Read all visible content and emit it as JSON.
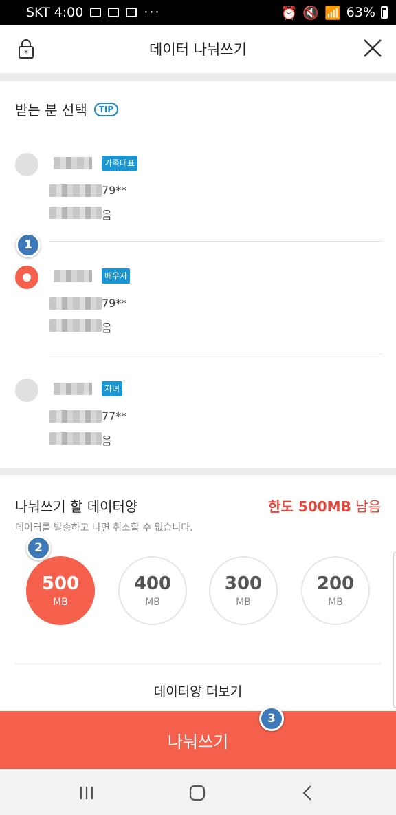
{
  "status": {
    "carrier_time": "SKT 4:00",
    "dots": "···",
    "battery": "63%"
  },
  "header": {
    "title": "데이터 나눠쓰기"
  },
  "recipients": {
    "title": "받는 분 선택",
    "tip": "TIP",
    "members": [
      {
        "role": "가족대표",
        "phone_tail": "79**",
        "usage_tail": "음",
        "selected": false
      },
      {
        "role": "배우자",
        "phone_tail": "79**",
        "usage_tail": "음",
        "selected": true
      },
      {
        "role": "자녀",
        "phone_tail": "77**",
        "usage_tail": "음",
        "selected": false
      }
    ]
  },
  "steps": [
    "1",
    "2",
    "3"
  ],
  "data_share": {
    "title": "나눠쓰기 할 데이터양",
    "limit_strong": "한도 500MB",
    "limit_rest": " 남음",
    "notice": "데이터를 발송하고 나면 취소할 수 없습니다.",
    "amounts": [
      {
        "value": "500",
        "unit": "MB",
        "selected": true
      },
      {
        "value": "400",
        "unit": "MB",
        "selected": false
      },
      {
        "value": "300",
        "unit": "MB",
        "selected": false
      },
      {
        "value": "200",
        "unit": "MB",
        "selected": false
      }
    ],
    "more": "데이터양 더보기"
  },
  "cta": {
    "label": "나눠쓰기"
  },
  "colors": {
    "accent": "#f4604c",
    "badge": "#1a96d4",
    "step": "#3d78b8",
    "limit": "#e4483c"
  }
}
